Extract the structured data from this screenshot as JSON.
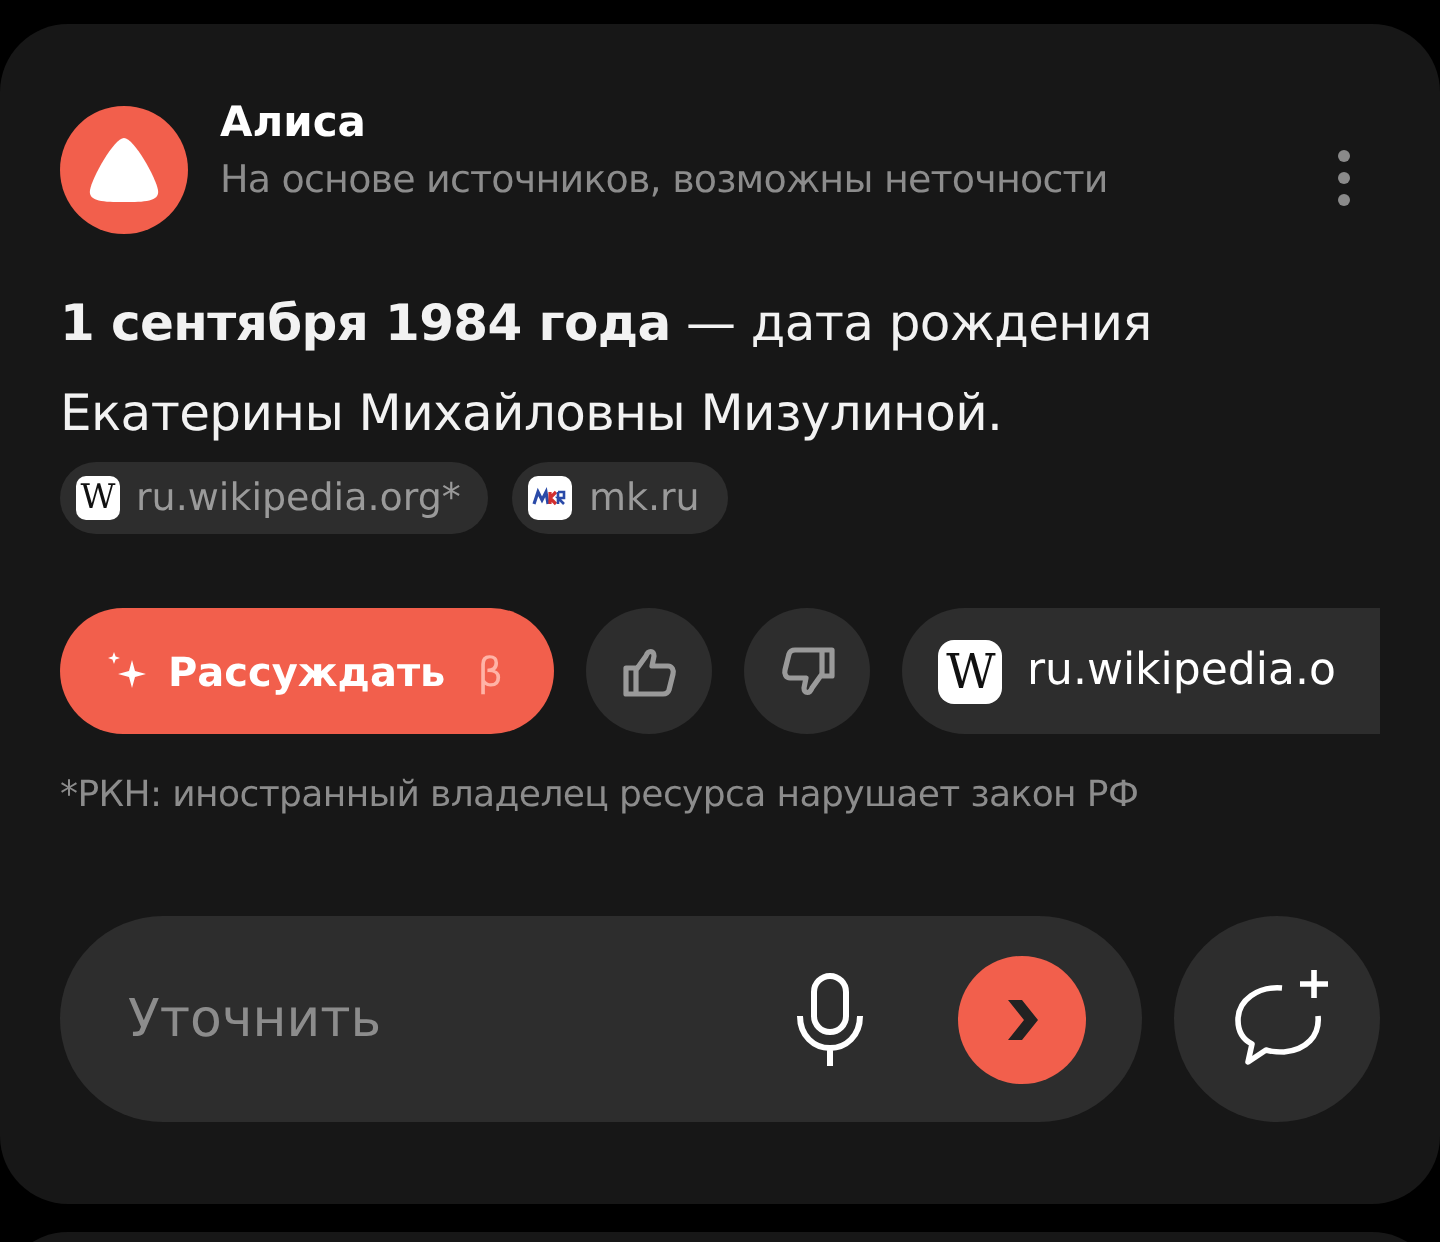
{
  "header": {
    "name": "Алиса",
    "subtitle": "На основе источников, возможны неточности"
  },
  "answer": "**1 сентября 1984 года** — дата рождения Екатерины Михайловны Мизулиной.",
  "sources": [
    {
      "kind": "wiki",
      "glyph": "W",
      "label": "ru.wikipedia.org*"
    },
    {
      "kind": "mk",
      "label": "mk.ru"
    }
  ],
  "actions": {
    "reason_button": {
      "label": "Рассуждать",
      "badge": "β"
    },
    "source_chip": {
      "glyph": "W",
      "label": "ru.wikipedia.o"
    }
  },
  "footnote": "*РКН: иностранный владелец ресурса нарушает закон РФ",
  "input": {
    "placeholder": "Уточнить"
  }
}
